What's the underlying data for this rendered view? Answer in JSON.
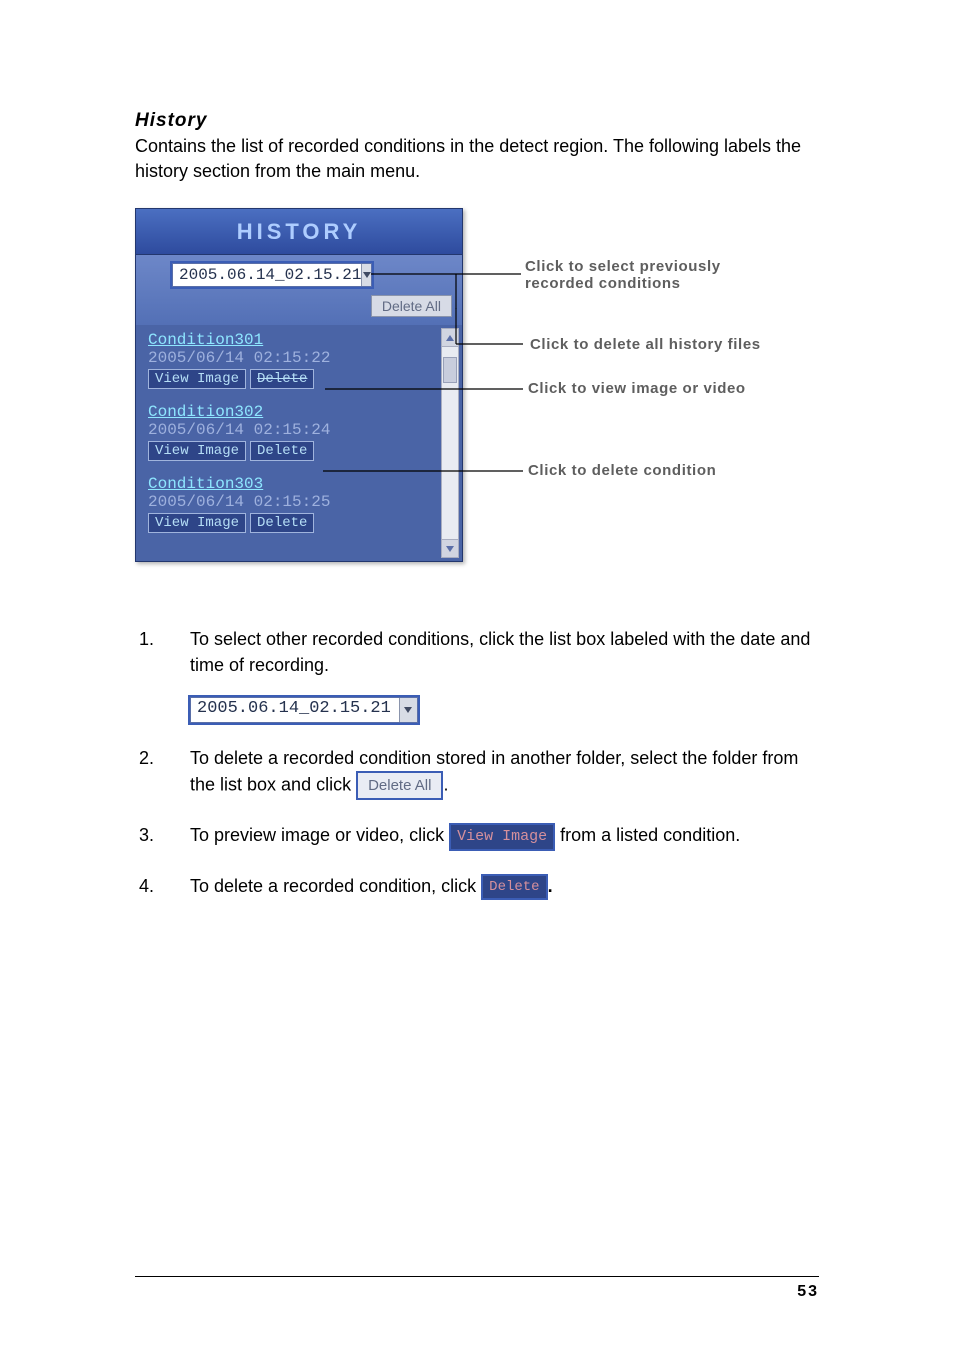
{
  "heading": "History",
  "intro": "Contains the list of recorded conditions in the detect region. The following labels the history section from the main menu.",
  "panel": {
    "title": "HISTORY",
    "select_value": "2005.06.14_02.15.21",
    "delete_all": "Delete All",
    "items": [
      {
        "cond": "Condition301",
        "ts": "2005/06/14 02:15:22",
        "view": "View Image",
        "del": "Delete"
      },
      {
        "cond": "Condition302",
        "ts": "2005/06/14 02:15:24",
        "view": "View Image",
        "del": "Delete"
      },
      {
        "cond": "Condition303",
        "ts": "2005/06/14 02:15:25",
        "view": "View Image",
        "del": "Delete"
      }
    ]
  },
  "callouts": {
    "select": "Click to select previously recorded conditions",
    "delete_all": "Click to delete all history files",
    "view": "Click to view image or video",
    "del": "Click to delete condition"
  },
  "steps": {
    "s1": "To select other recorded conditions, click the list box labeled with the date and time of recording.",
    "s1_select": "2005.06.14_02.15.21",
    "s2a": "To delete a recorded condition stored in another folder, select the folder from the list box and click ",
    "s2_btn": "Delete All",
    "s2b": ".",
    "s3a": "To preview image or video, click ",
    "s3_btn": "View Image",
    "s3b": " from a listed condition.",
    "s4a": "To delete a recorded condition, click ",
    "s4_btn": "Delete",
    "s4b": "."
  },
  "page_number": "53"
}
